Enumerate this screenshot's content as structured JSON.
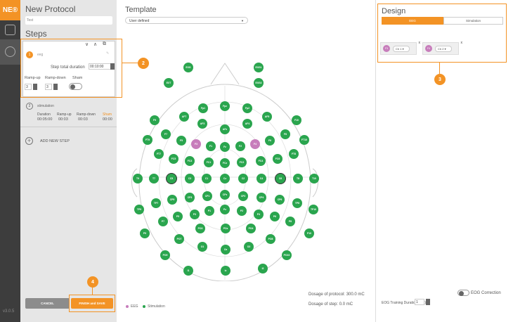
{
  "app": {
    "logo": "NE®",
    "version": "v3.0.5"
  },
  "protocol": {
    "title": "New Protocol",
    "name_value": "Test",
    "steps_title": "Steps"
  },
  "step1": {
    "number": "1",
    "name": "eeg",
    "total_duration_label": "Step total duration",
    "total_duration_value": "00:10:00",
    "rampup_label": "Ramp-up",
    "rampdown_label": "Ramp-down",
    "sham_label": "Sham",
    "rampup_value": "3",
    "rampdown_value": "3"
  },
  "step2": {
    "number": "2",
    "name": "stimulation",
    "duration_label": "Duration",
    "rampup_label": "Ramp-up",
    "rampdown_label": "Ramp-down",
    "sham_label": "Sham",
    "duration_value": "00:05:00",
    "rampup_value": "00:03",
    "rampdown_value": "00:03",
    "sham_value": "00:00"
  },
  "add_step": "ADD NEW STEP",
  "buttons": {
    "cancel": "CANCEL",
    "finish": "FINISH and SAVE"
  },
  "callouts": {
    "c2": "2",
    "c3": "3",
    "c4": "4"
  },
  "template": {
    "title": "Template",
    "select_value": "User defined"
  },
  "legend": {
    "eeg": "EEG",
    "stim": "Stimulation",
    "eeg_color": "#c77dbb",
    "stim_color": "#2aa54e"
  },
  "dosage": {
    "protocol": "Dosage of protocol: 300.0 mC",
    "step": "Dosage of step: 0.0 mC"
  },
  "design": {
    "title": "Design",
    "tab_eeg": "EEG",
    "tab_stim": "Simulation",
    "chip1_badge": "F3",
    "chip1_ch": "Ch 1",
    "chip2_badge": "F4",
    "chip2_ch": "Ch 2",
    "close": "x"
  },
  "eog": {
    "correction_label": "EOG Correction",
    "duration_label": "EOG Training Duration (sec)",
    "duration_value": "1"
  },
  "colors": {
    "accent": "#f39325",
    "sidebar": "#3d3d3d",
    "panel": "#e6e6e6",
    "cancel_btn": "#8c8c8c"
  },
  "electrodes": [
    {
      "label": "EXG",
      "type": "stim"
    },
    {
      "label": "EXG1",
      "type": "stim"
    },
    {
      "label": "EXT",
      "type": "stim"
    },
    {
      "label": "EXG2",
      "type": "stim"
    },
    {
      "label": "Fp1",
      "type": "stim"
    },
    {
      "label": "Fpz",
      "type": "stim"
    },
    {
      "label": "Fp2",
      "type": "stim"
    },
    {
      "label": "AF7",
      "type": "stim"
    },
    {
      "label": "AF3",
      "type": "stim"
    },
    {
      "label": "AFz",
      "type": "stim"
    },
    {
      "label": "AF4",
      "type": "stim"
    },
    {
      "label": "AF8",
      "type": "stim"
    },
    {
      "label": "F9",
      "type": "stim"
    },
    {
      "label": "F10",
      "type": "stim"
    },
    {
      "label": "F7",
      "type": "stim"
    },
    {
      "label": "F5",
      "type": "stim"
    },
    {
      "label": "F3",
      "type": "eeg"
    },
    {
      "label": "F1",
      "type": "stim"
    },
    {
      "label": "Fz",
      "type": "stim"
    },
    {
      "label": "F2",
      "type": "stim"
    },
    {
      "label": "F4",
      "type": "eeg"
    },
    {
      "label": "F6",
      "type": "stim"
    },
    {
      "label": "F8",
      "type": "stim"
    },
    {
      "label": "FT9",
      "type": "stim"
    },
    {
      "label": "FT10",
      "type": "stim"
    },
    {
      "label": "FT7",
      "type": "stim"
    },
    {
      "label": "FC5",
      "type": "stim"
    },
    {
      "label": "FC3",
      "type": "stim"
    },
    {
      "label": "FC1",
      "type": "stim"
    },
    {
      "label": "FCz",
      "type": "stim"
    },
    {
      "label": "FC2",
      "type": "stim"
    },
    {
      "label": "FC4",
      "type": "stim"
    },
    {
      "label": "FC6",
      "type": "stim"
    },
    {
      "label": "FT8",
      "type": "stim"
    },
    {
      "label": "T9",
      "type": "stim"
    },
    {
      "label": "T7",
      "type": "stim"
    },
    {
      "label": "C5",
      "type": "stim",
      "ring": true
    },
    {
      "label": "C3",
      "type": "stim"
    },
    {
      "label": "C1",
      "type": "stim"
    },
    {
      "label": "Cz",
      "type": "stim"
    },
    {
      "label": "C2",
      "type": "stim"
    },
    {
      "label": "C4",
      "type": "stim"
    },
    {
      "label": "C6",
      "type": "stim",
      "ring": true
    },
    {
      "label": "T8",
      "type": "stim"
    },
    {
      "label": "T10",
      "type": "stim"
    },
    {
      "label": "TP7",
      "type": "stim"
    },
    {
      "label": "CP5",
      "type": "stim"
    },
    {
      "label": "CP3",
      "type": "stim"
    },
    {
      "label": "CP1",
      "type": "stim"
    },
    {
      "label": "CPz",
      "type": "stim"
    },
    {
      "label": "CP2",
      "type": "stim"
    },
    {
      "label": "CP4",
      "type": "stim"
    },
    {
      "label": "CP6",
      "type": "stim"
    },
    {
      "label": "TP8",
      "type": "stim"
    },
    {
      "label": "TP9",
      "type": "stim"
    },
    {
      "label": "TP10",
      "type": "stim"
    },
    {
      "label": "P7",
      "type": "stim"
    },
    {
      "label": "P5",
      "type": "stim"
    },
    {
      "label": "P3",
      "type": "stim"
    },
    {
      "label": "P1",
      "type": "stim"
    },
    {
      "label": "Pz",
      "type": "stim"
    },
    {
      "label": "P2",
      "type": "stim"
    },
    {
      "label": "P4",
      "type": "stim"
    },
    {
      "label": "P6",
      "type": "stim"
    },
    {
      "label": "P8",
      "type": "stim"
    },
    {
      "label": "P9",
      "type": "stim"
    },
    {
      "label": "PO3",
      "type": "stim"
    },
    {
      "label": "POz",
      "type": "stim"
    },
    {
      "label": "PO4",
      "type": "stim"
    },
    {
      "label": "P10",
      "type": "stim"
    },
    {
      "label": "PO7",
      "type": "stim"
    },
    {
      "label": "PO8",
      "type": "stim"
    },
    {
      "label": "O1",
      "type": "stim"
    },
    {
      "label": "Oz",
      "type": "stim"
    },
    {
      "label": "O2",
      "type": "stim"
    },
    {
      "label": "PO9",
      "type": "stim"
    },
    {
      "label": "PO10",
      "type": "stim"
    },
    {
      "label": "I1",
      "type": "stim"
    },
    {
      "label": "Iz",
      "type": "stim"
    },
    {
      "label": "I2",
      "type": "stim"
    }
  ]
}
